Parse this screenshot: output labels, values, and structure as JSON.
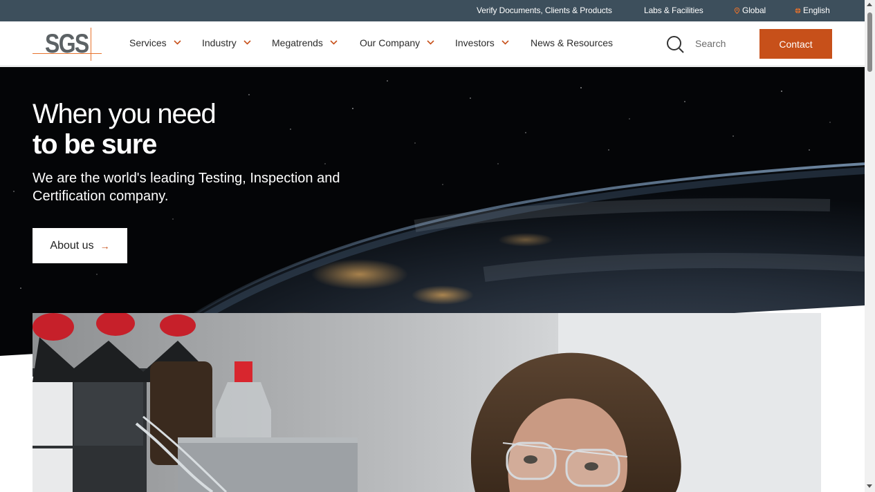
{
  "topbar": {
    "verify": "Verify Documents, Clients & Products",
    "labs": "Labs & Facilities",
    "global": "Global",
    "language": "English",
    "icon_location": "location-pin-icon",
    "icon_globe": "globe-icon"
  },
  "header": {
    "logo_text": "SGS",
    "nav": [
      {
        "label": "Services",
        "has_dropdown": true
      },
      {
        "label": "Industry",
        "has_dropdown": true
      },
      {
        "label": "Megatrends",
        "has_dropdown": true
      },
      {
        "label": "Our Company",
        "has_dropdown": true
      },
      {
        "label": "Investors",
        "has_dropdown": true
      },
      {
        "label": "News & Resources",
        "has_dropdown": false
      }
    ],
    "search_label": "Search",
    "contact_label": "Contact"
  },
  "hero": {
    "title_line1": "When you need",
    "title_line2": "to be sure",
    "subtitle": "We are the world's leading Testing, Inspection and Certification company.",
    "cta_label": "About us",
    "cta_arrow": "→"
  },
  "colors": {
    "topbar_bg": "#3d4f5c",
    "accent": "#c7501a",
    "hero_bg": "#050608",
    "logo_gray": "#5c6265",
    "logo_orange": "#e8722c"
  }
}
